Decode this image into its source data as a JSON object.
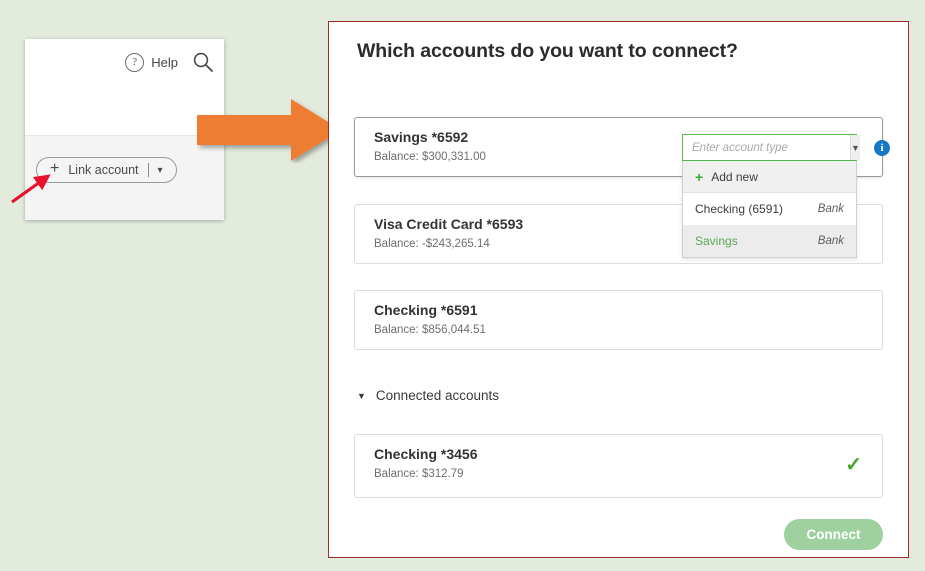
{
  "background_color": "#e3ebdd",
  "left_panel": {
    "help_icon": "question-circle-icon",
    "help_label": "Help",
    "search_icon": "search-icon",
    "link_account": {
      "plus_icon": "plus-icon",
      "label": "Link account",
      "divider": "|",
      "caret_icon": "chevron-down-icon"
    },
    "secondary_button_icon": "refresh-icon"
  },
  "annotations": {
    "orange_arrow_color": "#ED7D31",
    "red_pointer_color": "#E8112D"
  },
  "main_panel": {
    "border_color": "#9e2a2a",
    "title": "Which accounts do you want to connect?",
    "accounts": [
      {
        "name": "Savings *6592",
        "balance": "Balance: $300,331.00",
        "selected": true
      },
      {
        "name": "Visa Credit Card *6593",
        "balance": "Balance: -$243,265.14",
        "selected": false
      },
      {
        "name": "Checking *6591",
        "balance": "Balance: $856,044.51",
        "selected": false
      }
    ],
    "account_type_select": {
      "placeholder": "Enter account type",
      "value": "",
      "caret_icon": "chevron-down-icon",
      "border_color": "#53b947",
      "info_icon": "info-icon",
      "info_icon_color": "#1678c2",
      "options": [
        {
          "label": "Add new",
          "type": "",
          "is_add_new": true,
          "highlighted": false
        },
        {
          "label": "Checking (6591)",
          "type": "Bank",
          "is_add_new": false,
          "highlighted": false
        },
        {
          "label": "Savings",
          "type": "Bank",
          "is_add_new": false,
          "highlighted": true
        }
      ]
    },
    "connected_section": {
      "caret_icon": "caret-down-icon",
      "label": "Connected accounts",
      "accounts": [
        {
          "name": "Checking *3456",
          "balance": "Balance: $312.79",
          "check_icon": "check-icon",
          "check_color": "#41a62a"
        }
      ]
    },
    "connect_button": {
      "label": "Connect",
      "color": "#9ed0a0",
      "disabled": true
    }
  }
}
